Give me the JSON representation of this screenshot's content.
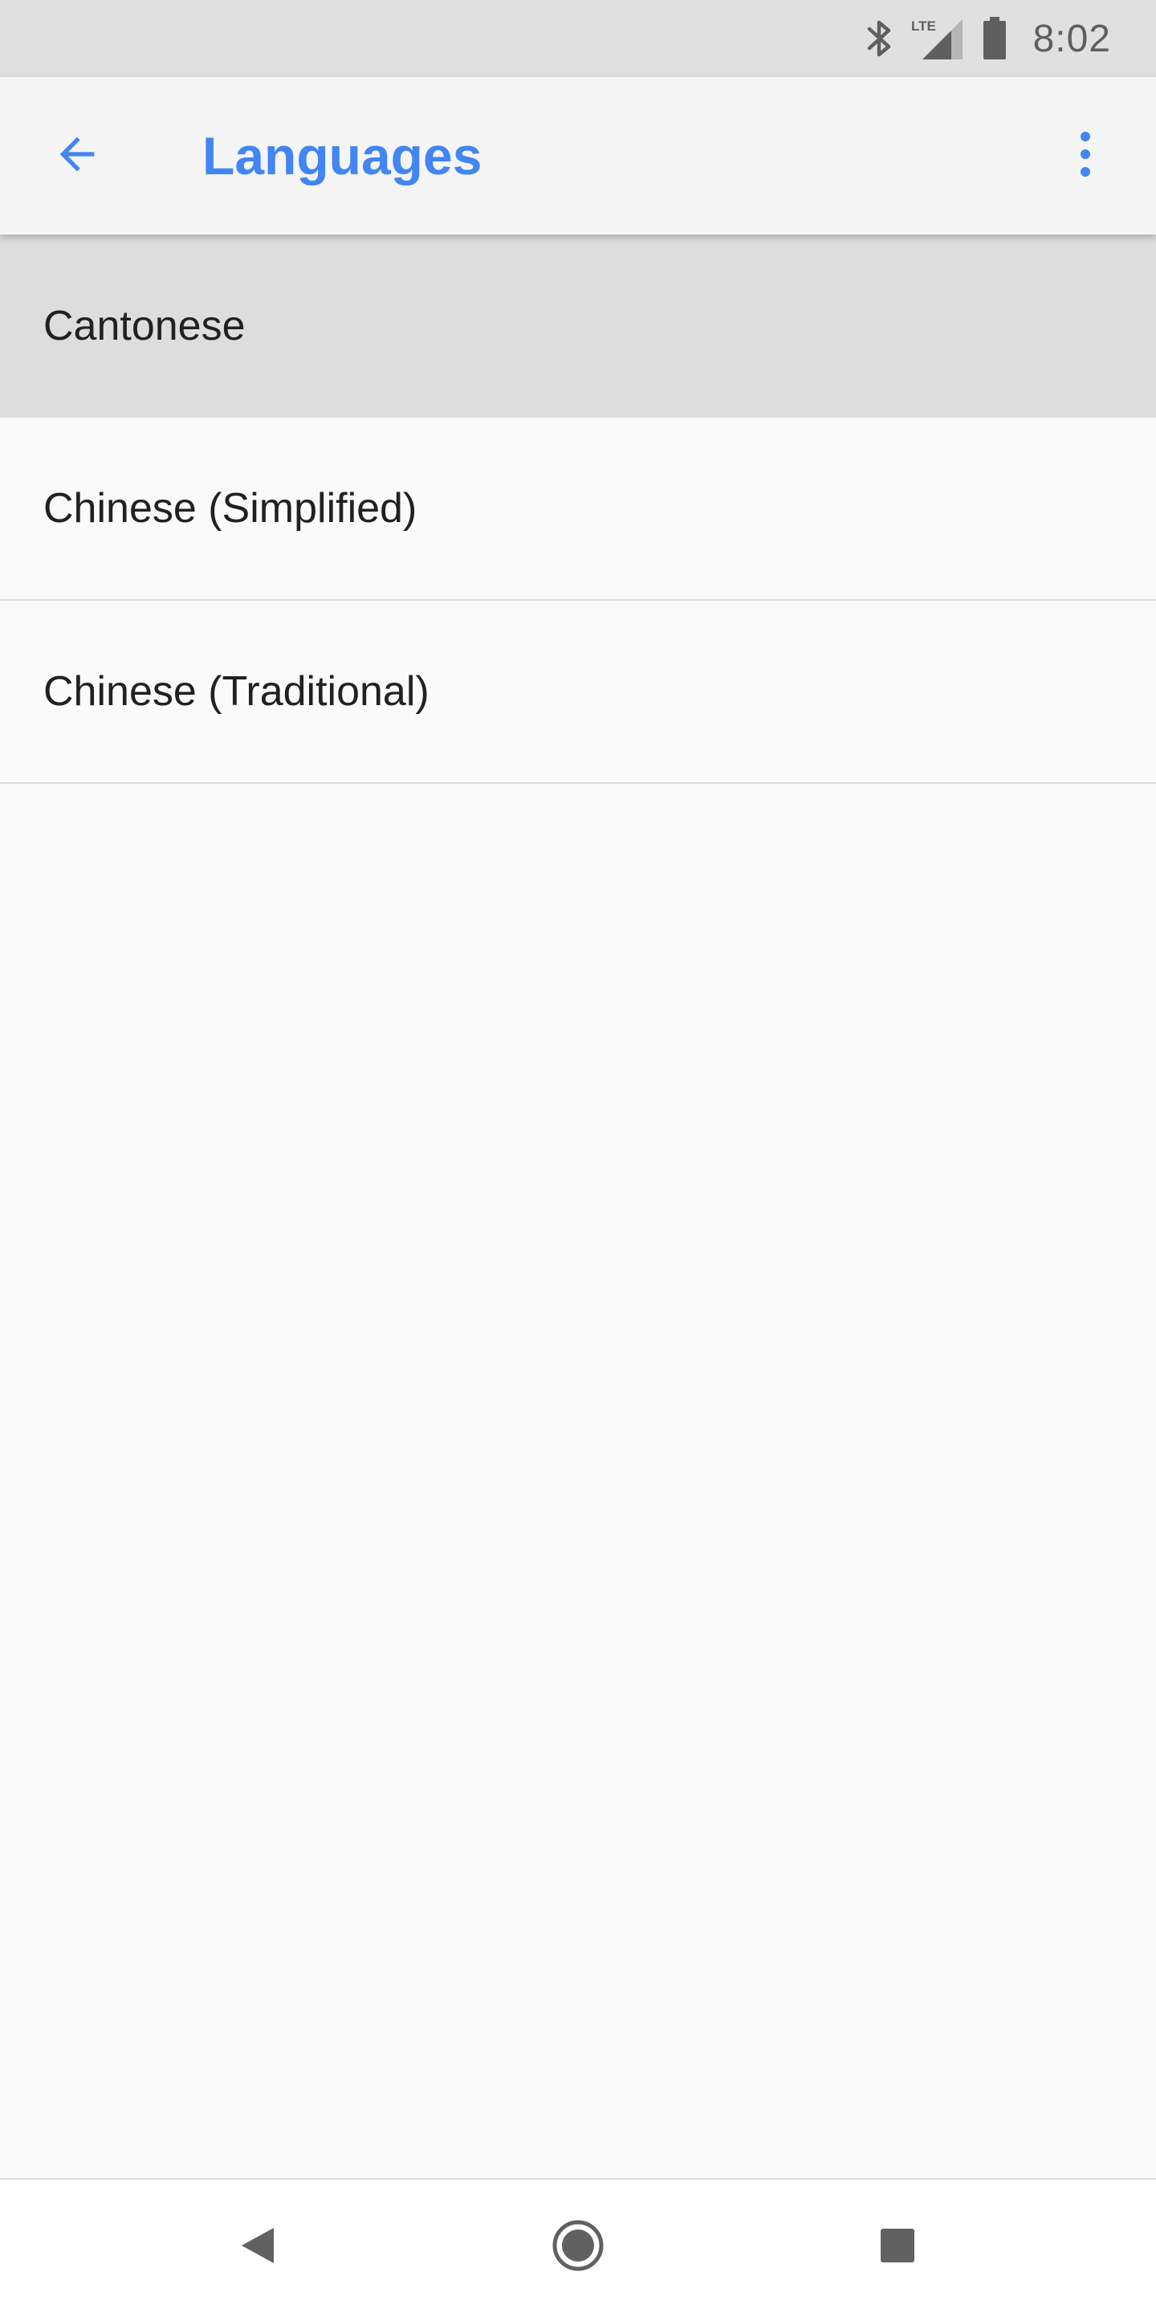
{
  "status_bar": {
    "time": "8:02",
    "network_label": "LTE",
    "icons": [
      "bluetooth-icon",
      "lte-signal-icon",
      "battery-icon"
    ]
  },
  "app_bar": {
    "title": "Languages",
    "back_icon": "arrow-back-icon",
    "overflow_icon": "more-vert-icon"
  },
  "languages": [
    {
      "label": "Cantonese",
      "selected": true
    },
    {
      "label": "Chinese (Simplified)",
      "selected": false
    },
    {
      "label": "Chinese (Traditional)",
      "selected": false
    }
  ],
  "nav_bar": {
    "icons": [
      "nav-back-icon",
      "nav-home-icon",
      "nav-recents-icon"
    ]
  },
  "colors": {
    "accent": "#4285f4",
    "status_bar_bg": "#e0e0e0",
    "app_bar_bg": "#f5f5f5",
    "selected_row_bg": "#dddddd",
    "list_bg": "#fafafa",
    "text_primary": "#212121",
    "system_icon": "#5f5f5f"
  }
}
